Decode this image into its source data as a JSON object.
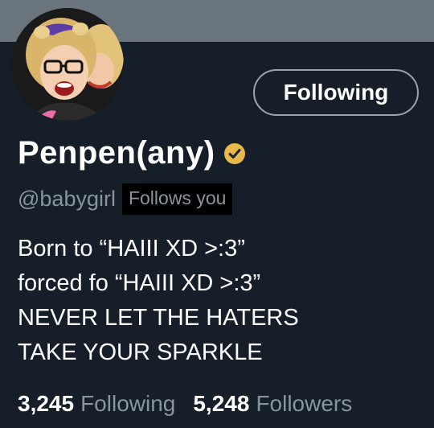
{
  "profile": {
    "display_name": "Penpen(any)",
    "handle": "@babygirl",
    "follows_you_badge": "Follows you",
    "verified_icon": "verified-badge-icon",
    "bio_lines": [
      "Born to “HAIII XD >:3”",
      "forced fo “HAIII XD >:3”",
      "NEVER LET THE HATERS",
      "TAKE YOUR SPARKLE"
    ]
  },
  "actions": {
    "follow_button_label": "Following"
  },
  "stats": {
    "following_count": "3,245",
    "following_label": "Following",
    "followers_count": "5,248",
    "followers_label": "Followers"
  },
  "colors": {
    "background": "#161f29",
    "banner": "#6a747d",
    "secondary_text": "#8a949d",
    "verified_gold": "#e8b84a"
  }
}
